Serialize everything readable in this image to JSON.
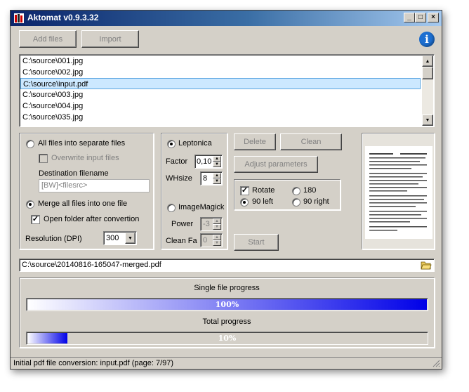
{
  "window": {
    "title": "Aktomat v0.9.3.32",
    "minimize_glyph": "_",
    "maximize_glyph": "□",
    "close_glyph": "×"
  },
  "toolbar": {
    "add_files_label": "Add files",
    "import_label": "Import",
    "info_glyph": "i",
    "info_color": "#1d6fd1"
  },
  "files": {
    "items": [
      "C:\\source\\001.jpg",
      "C:\\source\\002.jpg",
      "C:\\source\\input.pdf",
      "C:\\source\\003.jpg",
      "C:\\source\\004.jpg",
      "C:\\source\\035.jpg"
    ],
    "selected_index": 2
  },
  "output_options": {
    "separate_files_label": "All files into separate files",
    "separate_files_selected": false,
    "overwrite_label": "Overwrite input files",
    "overwrite_checked": false,
    "destination_label": "Destination filename",
    "destination_value": "[BW]<filesrc>",
    "merge_label": "Merge all files into one file",
    "merge_selected": true,
    "open_folder_label": "Open folder after convertion",
    "open_folder_checked": true,
    "resolution_label": "Resolution (DPI)",
    "resolution_value": "300"
  },
  "engine": {
    "leptonica_label": "Leptonica",
    "leptonica_selected": true,
    "factor_label": "Factor",
    "factor_value": "0,10",
    "whsize_label": "WHsize",
    "whsize_value": "8",
    "imagemagick_label": "ImageMagick",
    "imagemagick_selected": false,
    "power_label": "Power",
    "power_value": "-3",
    "cleanfa_label": "Clean Fa",
    "cleanfa_value": "0"
  },
  "actions": {
    "delete_label": "Delete",
    "clean_label": "Clean",
    "adjust_label": "Adjust parameters",
    "start_label": "Start"
  },
  "rotation": {
    "rotate_label": "Rotate",
    "rotate_checked": true,
    "r180_label": "180",
    "r90left_label": "90 left",
    "r90right_label": "90 right",
    "selected": "90 left"
  },
  "output_path": {
    "value": "C:\\source\\20140816-165047-merged.pdf"
  },
  "progress": {
    "single_label": "Single file progress",
    "single_percent": 100,
    "single_text": "100%",
    "total_label": "Total progress",
    "total_percent": 10,
    "total_text": "10%"
  },
  "status": {
    "text": "Initial pdf file conversion: input.pdf (page: 7/97)"
  }
}
